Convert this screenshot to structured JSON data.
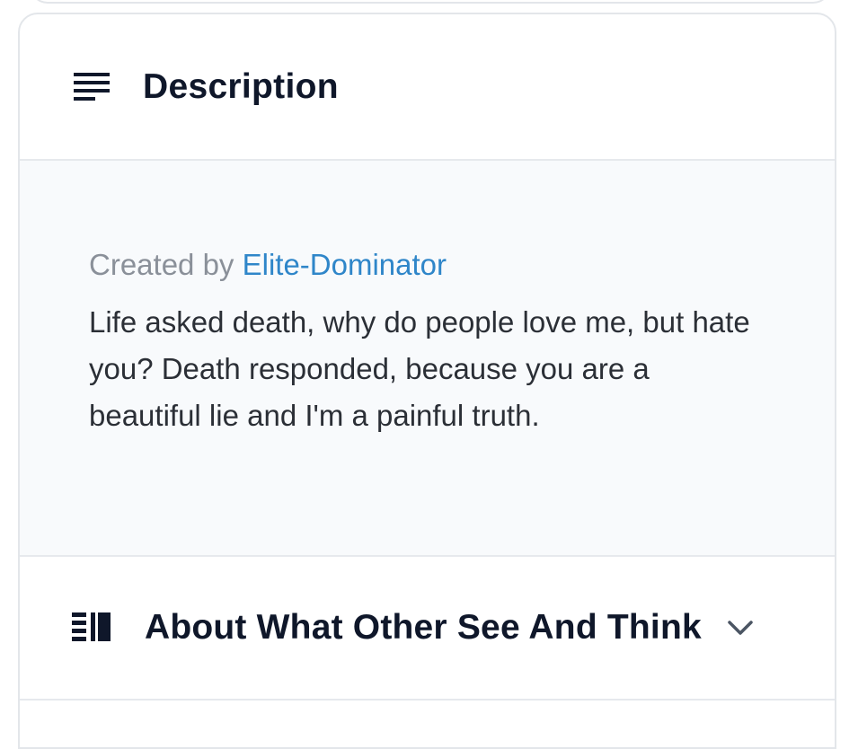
{
  "description_section": {
    "title": "Description",
    "icon": "align-left-icon",
    "created_by_prefix": "Created by",
    "author": "Elite-Dominator",
    "text": "Life asked death, why do people love me, but hate you? Death responded, because you are a beautiful lie and I'm a painful truth."
  },
  "about_section": {
    "title": "About What Other See And Think",
    "icon": "list-view-icon",
    "toggle_icon": "chevron-down-icon"
  },
  "colors": {
    "author_link": "#2f86c9",
    "heading": "#0f172a",
    "body_text": "#2b2f36",
    "muted_text": "#8a9099",
    "body_bg": "#f8fafc",
    "border": "#e3e6ea"
  }
}
